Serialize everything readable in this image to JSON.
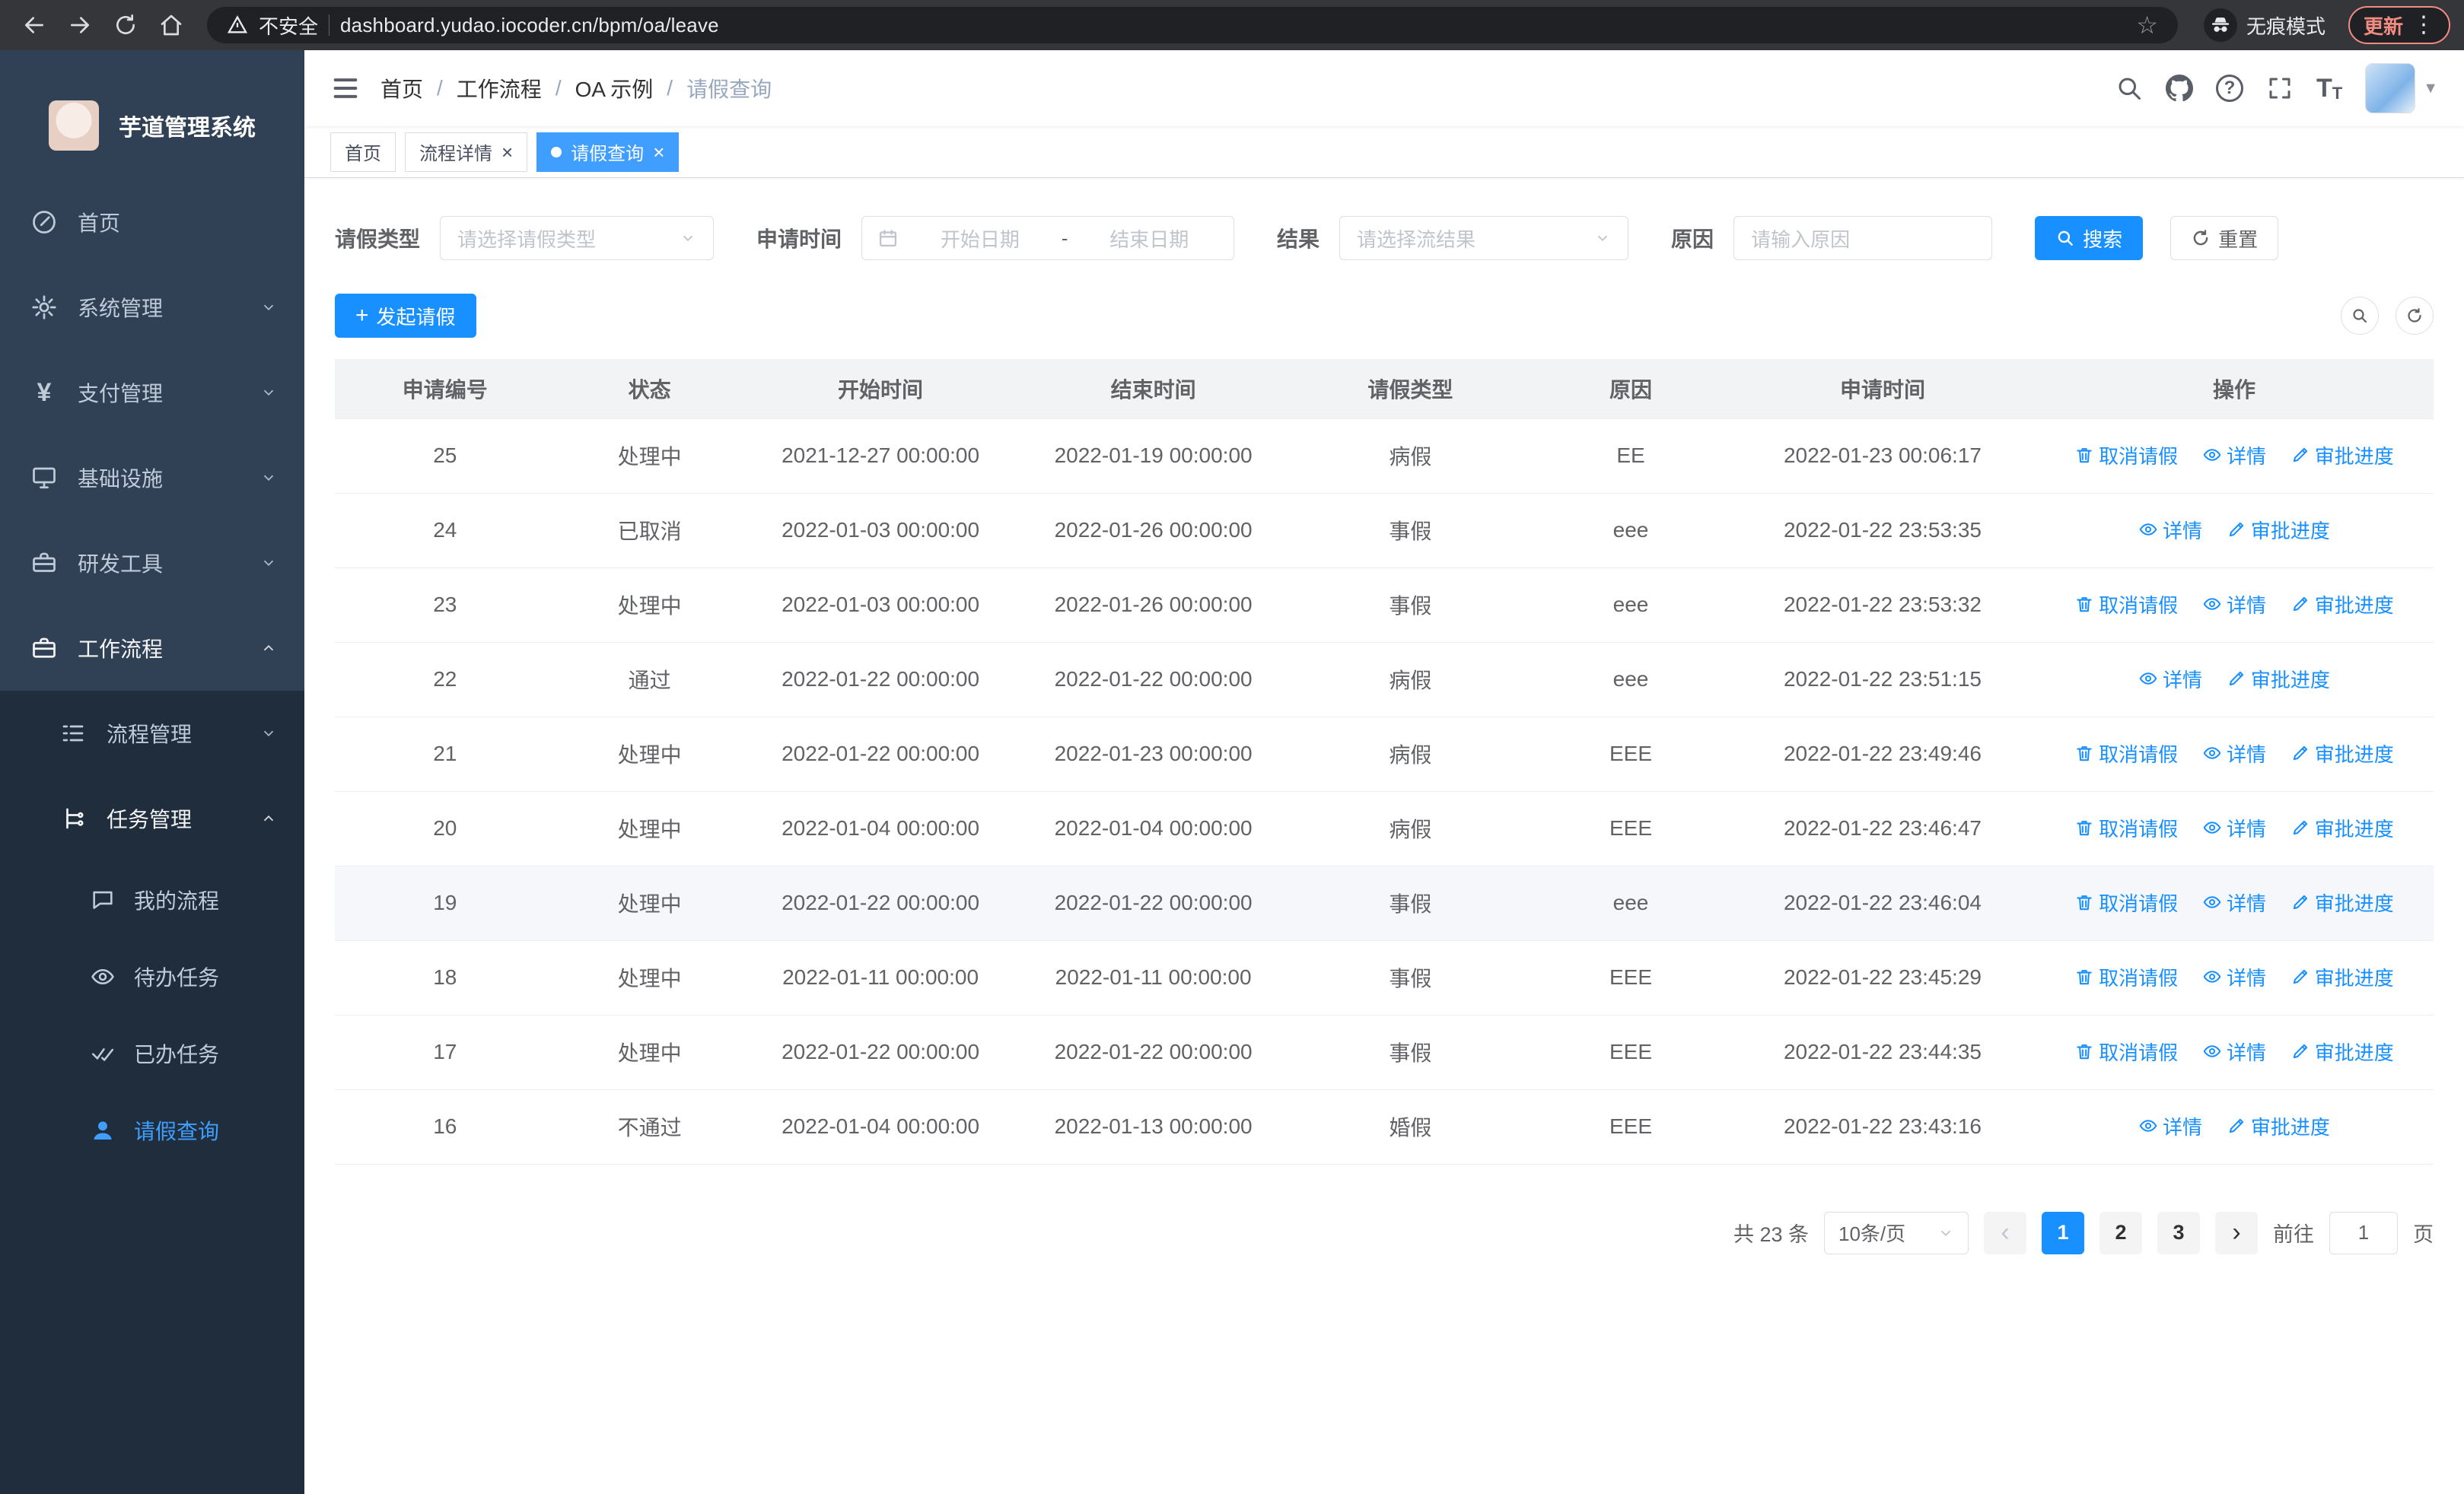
{
  "browser": {
    "security_label": "不安全",
    "url": "dashboard.yudao.iocoder.cn/bpm/oa/leave",
    "incognito_label": "无痕模式",
    "update_label": "更新"
  },
  "app": {
    "title": "芋道管理系统"
  },
  "sidebar": {
    "items": [
      {
        "label": "首页"
      },
      {
        "label": "系统管理"
      },
      {
        "label": "支付管理"
      },
      {
        "label": "基础设施"
      },
      {
        "label": "研发工具"
      },
      {
        "label": "工作流程"
      }
    ],
    "submenu": [
      {
        "label": "流程管理"
      },
      {
        "label": "任务管理"
      }
    ],
    "tasks": [
      {
        "label": "我的流程"
      },
      {
        "label": "待办任务"
      },
      {
        "label": "已办任务"
      },
      {
        "label": "请假查询"
      }
    ]
  },
  "breadcrumb": [
    "首页",
    "工作流程",
    "OA 示例",
    "请假查询"
  ],
  "tabs": [
    {
      "label": "首页"
    },
    {
      "label": "流程详情"
    },
    {
      "label": "请假查询"
    }
  ],
  "filters": {
    "leave_type_label": "请假类型",
    "leave_type_placeholder": "请选择请假类型",
    "apply_time_label": "申请时间",
    "start_date_placeholder": "开始日期",
    "range_separator": "-",
    "end_date_placeholder": "结束日期",
    "result_label": "结果",
    "result_placeholder": "请选择流结果",
    "reason_label": "原因",
    "reason_placeholder": "请输入原因",
    "search_label": "搜索",
    "reset_label": "重置"
  },
  "toolbar": {
    "create_label": "发起请假"
  },
  "table": {
    "columns": [
      "申请编号",
      "状态",
      "开始时间",
      "结束时间",
      "请假类型",
      "原因",
      "申请时间",
      "操作"
    ],
    "action_labels": {
      "cancel": "取消请假",
      "detail": "详情",
      "progress": "审批进度"
    },
    "rows": [
      {
        "id": "25",
        "status": "处理中",
        "start": "2021-12-27 00:00:00",
        "end": "2022-01-19 00:00:00",
        "type": "病假",
        "reason": "EE",
        "applied": "2022-01-23 00:06:17",
        "cancelable": true
      },
      {
        "id": "24",
        "status": "已取消",
        "start": "2022-01-03 00:00:00",
        "end": "2022-01-26 00:00:00",
        "type": "事假",
        "reason": "eee",
        "applied": "2022-01-22 23:53:35",
        "cancelable": false
      },
      {
        "id": "23",
        "status": "处理中",
        "start": "2022-01-03 00:00:00",
        "end": "2022-01-26 00:00:00",
        "type": "事假",
        "reason": "eee",
        "applied": "2022-01-22 23:53:32",
        "cancelable": true
      },
      {
        "id": "22",
        "status": "通过",
        "start": "2022-01-22 00:00:00",
        "end": "2022-01-22 00:00:00",
        "type": "病假",
        "reason": "eee",
        "applied": "2022-01-22 23:51:15",
        "cancelable": false
      },
      {
        "id": "21",
        "status": "处理中",
        "start": "2022-01-22 00:00:00",
        "end": "2022-01-23 00:00:00",
        "type": "病假",
        "reason": "EEE",
        "applied": "2022-01-22 23:49:46",
        "cancelable": true
      },
      {
        "id": "20",
        "status": "处理中",
        "start": "2022-01-04 00:00:00",
        "end": "2022-01-04 00:00:00",
        "type": "病假",
        "reason": "EEE",
        "applied": "2022-01-22 23:46:47",
        "cancelable": true
      },
      {
        "id": "19",
        "status": "处理中",
        "start": "2022-01-22 00:00:00",
        "end": "2022-01-22 00:00:00",
        "type": "事假",
        "reason": "eee",
        "applied": "2022-01-22 23:46:04",
        "cancelable": true,
        "highlight": true
      },
      {
        "id": "18",
        "status": "处理中",
        "start": "2022-01-11 00:00:00",
        "end": "2022-01-11 00:00:00",
        "type": "事假",
        "reason": "EEE",
        "applied": "2022-01-22 23:45:29",
        "cancelable": true
      },
      {
        "id": "17",
        "status": "处理中",
        "start": "2022-01-22 00:00:00",
        "end": "2022-01-22 00:00:00",
        "type": "事假",
        "reason": "EEE",
        "applied": "2022-01-22 23:44:35",
        "cancelable": true
      },
      {
        "id": "16",
        "status": "不通过",
        "start": "2022-01-04 00:00:00",
        "end": "2022-01-13 00:00:00",
        "type": "婚假",
        "reason": "EEE",
        "applied": "2022-01-22 23:43:16",
        "cancelable": false
      }
    ]
  },
  "pagination": {
    "total_label": "共 23 条",
    "page_size": "10条/页",
    "pages": [
      "1",
      "2",
      "3"
    ],
    "active_page": "1",
    "goto_label": "前往",
    "goto_value": "1",
    "page_suffix": "页"
  },
  "colors": {
    "primary": "#1890ff",
    "tab_active": "#409eff",
    "sidebar_bg": "#304156",
    "submenu_bg": "#1f2d3d",
    "active_menu_text": "#409eff"
  },
  "icons": {
    "navbar": [
      "search-icon",
      "github-icon",
      "help-icon",
      "fullscreen-icon",
      "font-size-icon"
    ],
    "row_actions": [
      "trash-icon",
      "eye-icon",
      "edit-icon"
    ]
  }
}
